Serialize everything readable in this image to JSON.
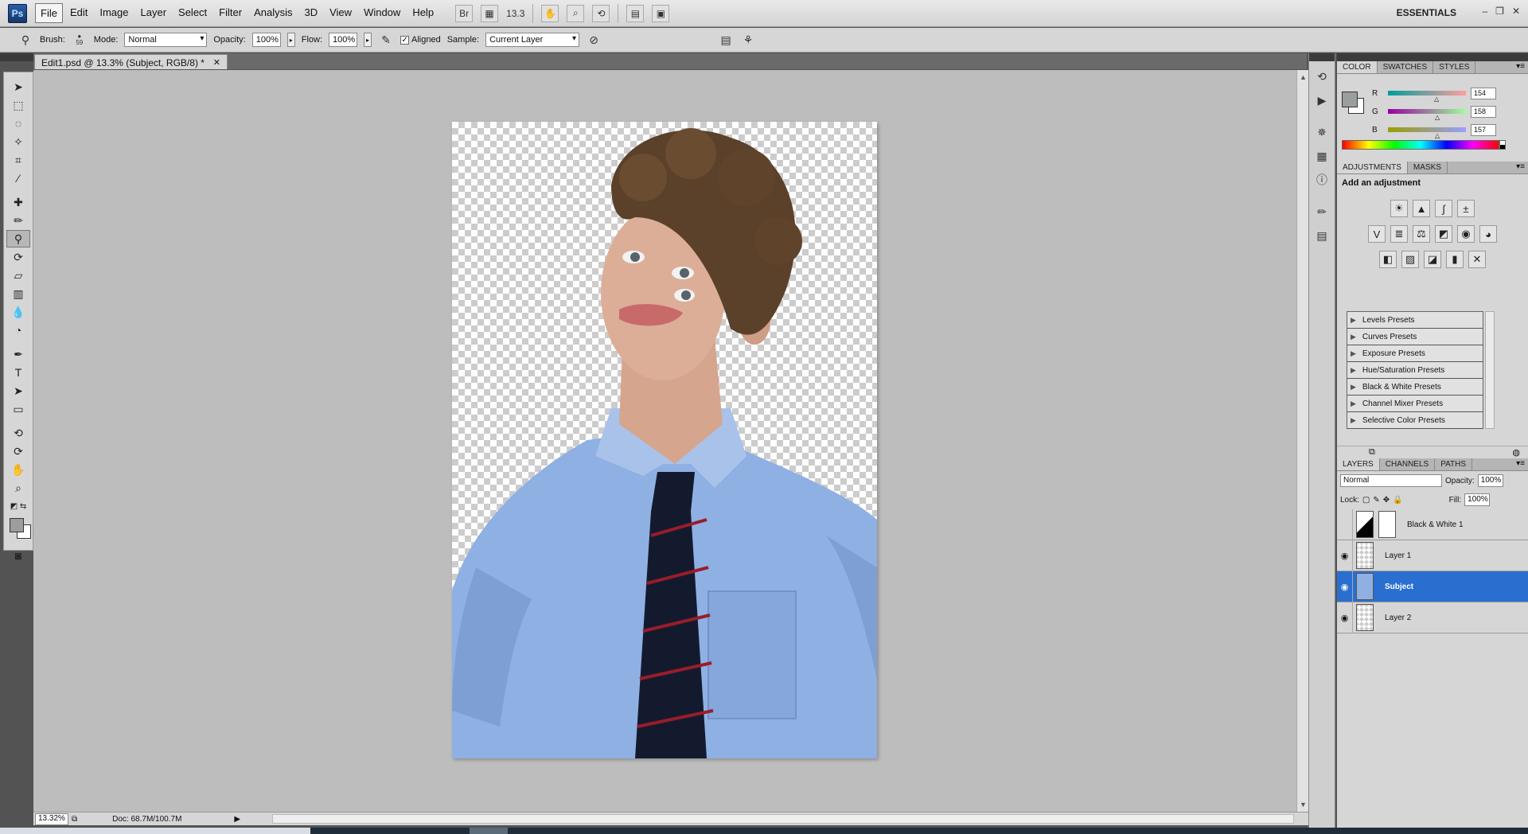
{
  "app": {
    "logo": "Ps",
    "menu": [
      "File",
      "Edit",
      "Image",
      "Layer",
      "Select",
      "Filter",
      "Analysis",
      "3D",
      "View",
      "Window",
      "Help"
    ],
    "bridge": "Br",
    "zoom_display": "13.3",
    "workspace": "ESSENTIALS",
    "window_controls": [
      "–",
      "❐",
      "✕"
    ]
  },
  "options": {
    "brush_label": "Brush:",
    "brush_size": "59",
    "mode_label": "Mode:",
    "mode_value": "Normal",
    "opacity_label": "Opacity:",
    "opacity_value": "100%",
    "flow_label": "Flow:",
    "flow_value": "100%",
    "aligned_label": "Aligned",
    "sample_label": "Sample:",
    "sample_value": "Current Layer"
  },
  "document": {
    "tab_title": "Edit1.psd @ 13.3% (Subject, RGB/8) *",
    "close": "✕",
    "zoom": "13.32%",
    "doc_info": "Doc: 68.7M/100.7M"
  },
  "color_panel": {
    "tabs": [
      "COLOR",
      "SWATCHES",
      "STYLES"
    ],
    "r_label": "R",
    "r": "154",
    "g_label": "G",
    "g": "158",
    "b_label": "B",
    "b": "157",
    "foreground": "#9a9e9d"
  },
  "adjustments": {
    "tabs": [
      "ADJUSTMENTS",
      "MASKS"
    ],
    "title": "Add an adjustment",
    "presets": [
      "Levels Presets",
      "Curves Presets",
      "Exposure Presets",
      "Hue/Saturation Presets",
      "Black & White Presets",
      "Channel Mixer Presets",
      "Selective Color Presets"
    ]
  },
  "layers": {
    "tabs": [
      "LAYERS",
      "CHANNELS",
      "PATHS"
    ],
    "blend_mode": "Normal",
    "opacity_label": "Opacity:",
    "opacity": "100%",
    "lock_label": "Lock:",
    "fill_label": "Fill:",
    "fill": "100%",
    "items": [
      {
        "name": "Black & White 1"
      },
      {
        "name": "Layer 1"
      },
      {
        "name": "Subject"
      },
      {
        "name": "Layer 2"
      }
    ]
  },
  "colors": {
    "selection": "#2a6fd0",
    "shirt": "#8fb0e3",
    "tie": "#141a2e",
    "tie_stripe": "#9a1c2a"
  }
}
